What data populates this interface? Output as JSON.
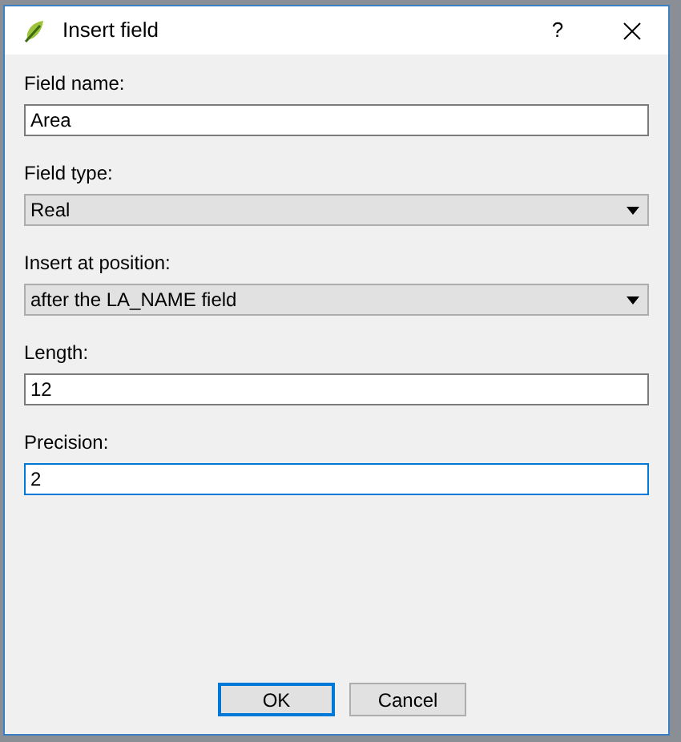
{
  "window": {
    "title": "Insert field",
    "help": "?"
  },
  "fields": [
    {
      "label": "Field name:",
      "kind": "text",
      "value": "Area",
      "focused": false
    },
    {
      "label": "Field type:",
      "kind": "combo",
      "value": "Real"
    },
    {
      "label": "Insert at position:",
      "kind": "combo",
      "value": "after the LA_NAME field"
    },
    {
      "label": "Length:",
      "kind": "text",
      "value": "12",
      "focused": false
    },
    {
      "label": "Precision:",
      "kind": "text",
      "value": "2",
      "focused": true
    }
  ],
  "buttons": [
    {
      "label": "OK",
      "default": true
    },
    {
      "label": "Cancel",
      "default": false
    }
  ]
}
